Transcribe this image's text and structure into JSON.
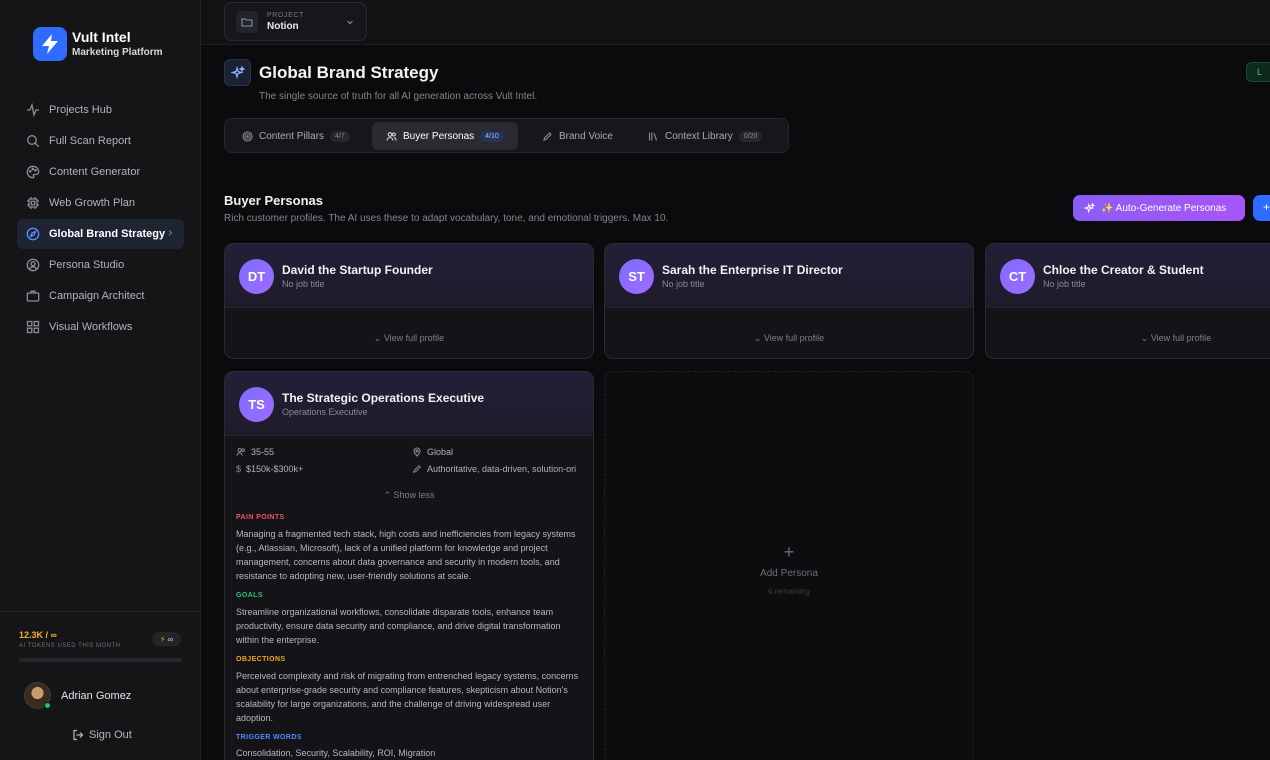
{
  "app": {
    "title": "Vult Intel",
    "subtitle": "Marketing Platform"
  },
  "sidebar": {
    "items": [
      {
        "label": "Projects Hub",
        "icon": "activity-icon"
      },
      {
        "label": "Full Scan Report",
        "icon": "search-icon"
      },
      {
        "label": "Content Generator",
        "icon": "palette-icon"
      },
      {
        "label": "Web Growth Plan",
        "icon": "cpu-icon"
      },
      {
        "label": "Global Brand Strategy",
        "icon": "compass-icon",
        "active": true
      },
      {
        "label": "Persona Studio",
        "icon": "user-circle-icon"
      },
      {
        "label": "Campaign Architect",
        "icon": "briefcase-icon"
      },
      {
        "label": "Visual Workflows",
        "icon": "grid-icon"
      }
    ],
    "tokens": {
      "value": "12.3K / ∞",
      "label": "AI TOKENS USED THIS MONTH",
      "badge": "∞"
    },
    "user": {
      "name": "Adrian Gomez",
      "status_color": "#22c55e"
    },
    "sign_out": "Sign Out"
  },
  "project": {
    "label": "PROJECT",
    "value": "Notion"
  },
  "header": {
    "title": "Global Brand Strategy",
    "subtitle": "The single source of truth for all AI generation across Vult Intel.",
    "status": "L"
  },
  "tabs": [
    {
      "label": "Content Pillars",
      "count": "4/7",
      "icon": "target-icon"
    },
    {
      "label": "Buyer Personas",
      "count": "4/10",
      "icon": "users-icon",
      "active": true
    },
    {
      "label": "Brand Voice",
      "count": "",
      "icon": "pen-icon"
    },
    {
      "label": "Context Library",
      "count": "0/20",
      "icon": "library-icon"
    }
  ],
  "section": {
    "title": "Buyer Personas",
    "subtitle": "Rich customer profiles. The AI uses these to adapt vocabulary, tone, and emotional triggers. Max 10.",
    "autogen_label": "✨ Auto-Generate Personas",
    "add_label": "+"
  },
  "personas": [
    {
      "initials": "DT",
      "name": "David the Startup Founder",
      "job": "No job title",
      "view": "View full profile"
    },
    {
      "initials": "ST",
      "name": "Sarah the Enterprise IT Director",
      "job": "No job title",
      "view": "View full profile"
    },
    {
      "initials": "CT",
      "name": "Chloe the Creator & Student",
      "job": "No job title",
      "view": "View full profile"
    }
  ],
  "expanded": {
    "initials": "TS",
    "name": "The Strategic Operations Executive",
    "job": "Operations Executive",
    "age": "35-55",
    "location": "Global",
    "income": "$150k-$300k+",
    "tone": "Authoritative, data-driven, solution-ori",
    "show_less": "Show less",
    "pain_points_title": "PAIN POINTS",
    "pain_points": "Managing a fragmented tech stack, high costs and inefficiencies from legacy systems (e.g., Atlassian, Microsoft), lack of a unified platform for knowledge and project management, concerns about data governance and security in modern tools, and resistance to adopting new, user-friendly solutions at scale.",
    "goals_title": "GOALS",
    "goals": "Streamline organizational workflows, consolidate disparate tools, enhance team productivity, ensure data security and compliance, and drive digital transformation within the enterprise.",
    "objections_title": "OBJECTIONS",
    "objections": "Perceived complexity and risk of migrating from entrenched legacy systems, concerns about enterprise-grade security and compliance features, skepticism about Notion's scalability for large organizations, and the challenge of driving widespread user adoption.",
    "triggers_title": "TRIGGER WORDS",
    "triggers": "Consolidation, Security, Scalability, ROI, Migration"
  },
  "add_persona": {
    "label": "Add Persona",
    "remaining": "6 remaining"
  },
  "colors": {
    "accent": "#2f6bff",
    "pain": "#f05263",
    "goals": "#2fc46f",
    "objections": "#f2a51e",
    "triggers": "#4a8dff",
    "gen": "#a855f7"
  }
}
